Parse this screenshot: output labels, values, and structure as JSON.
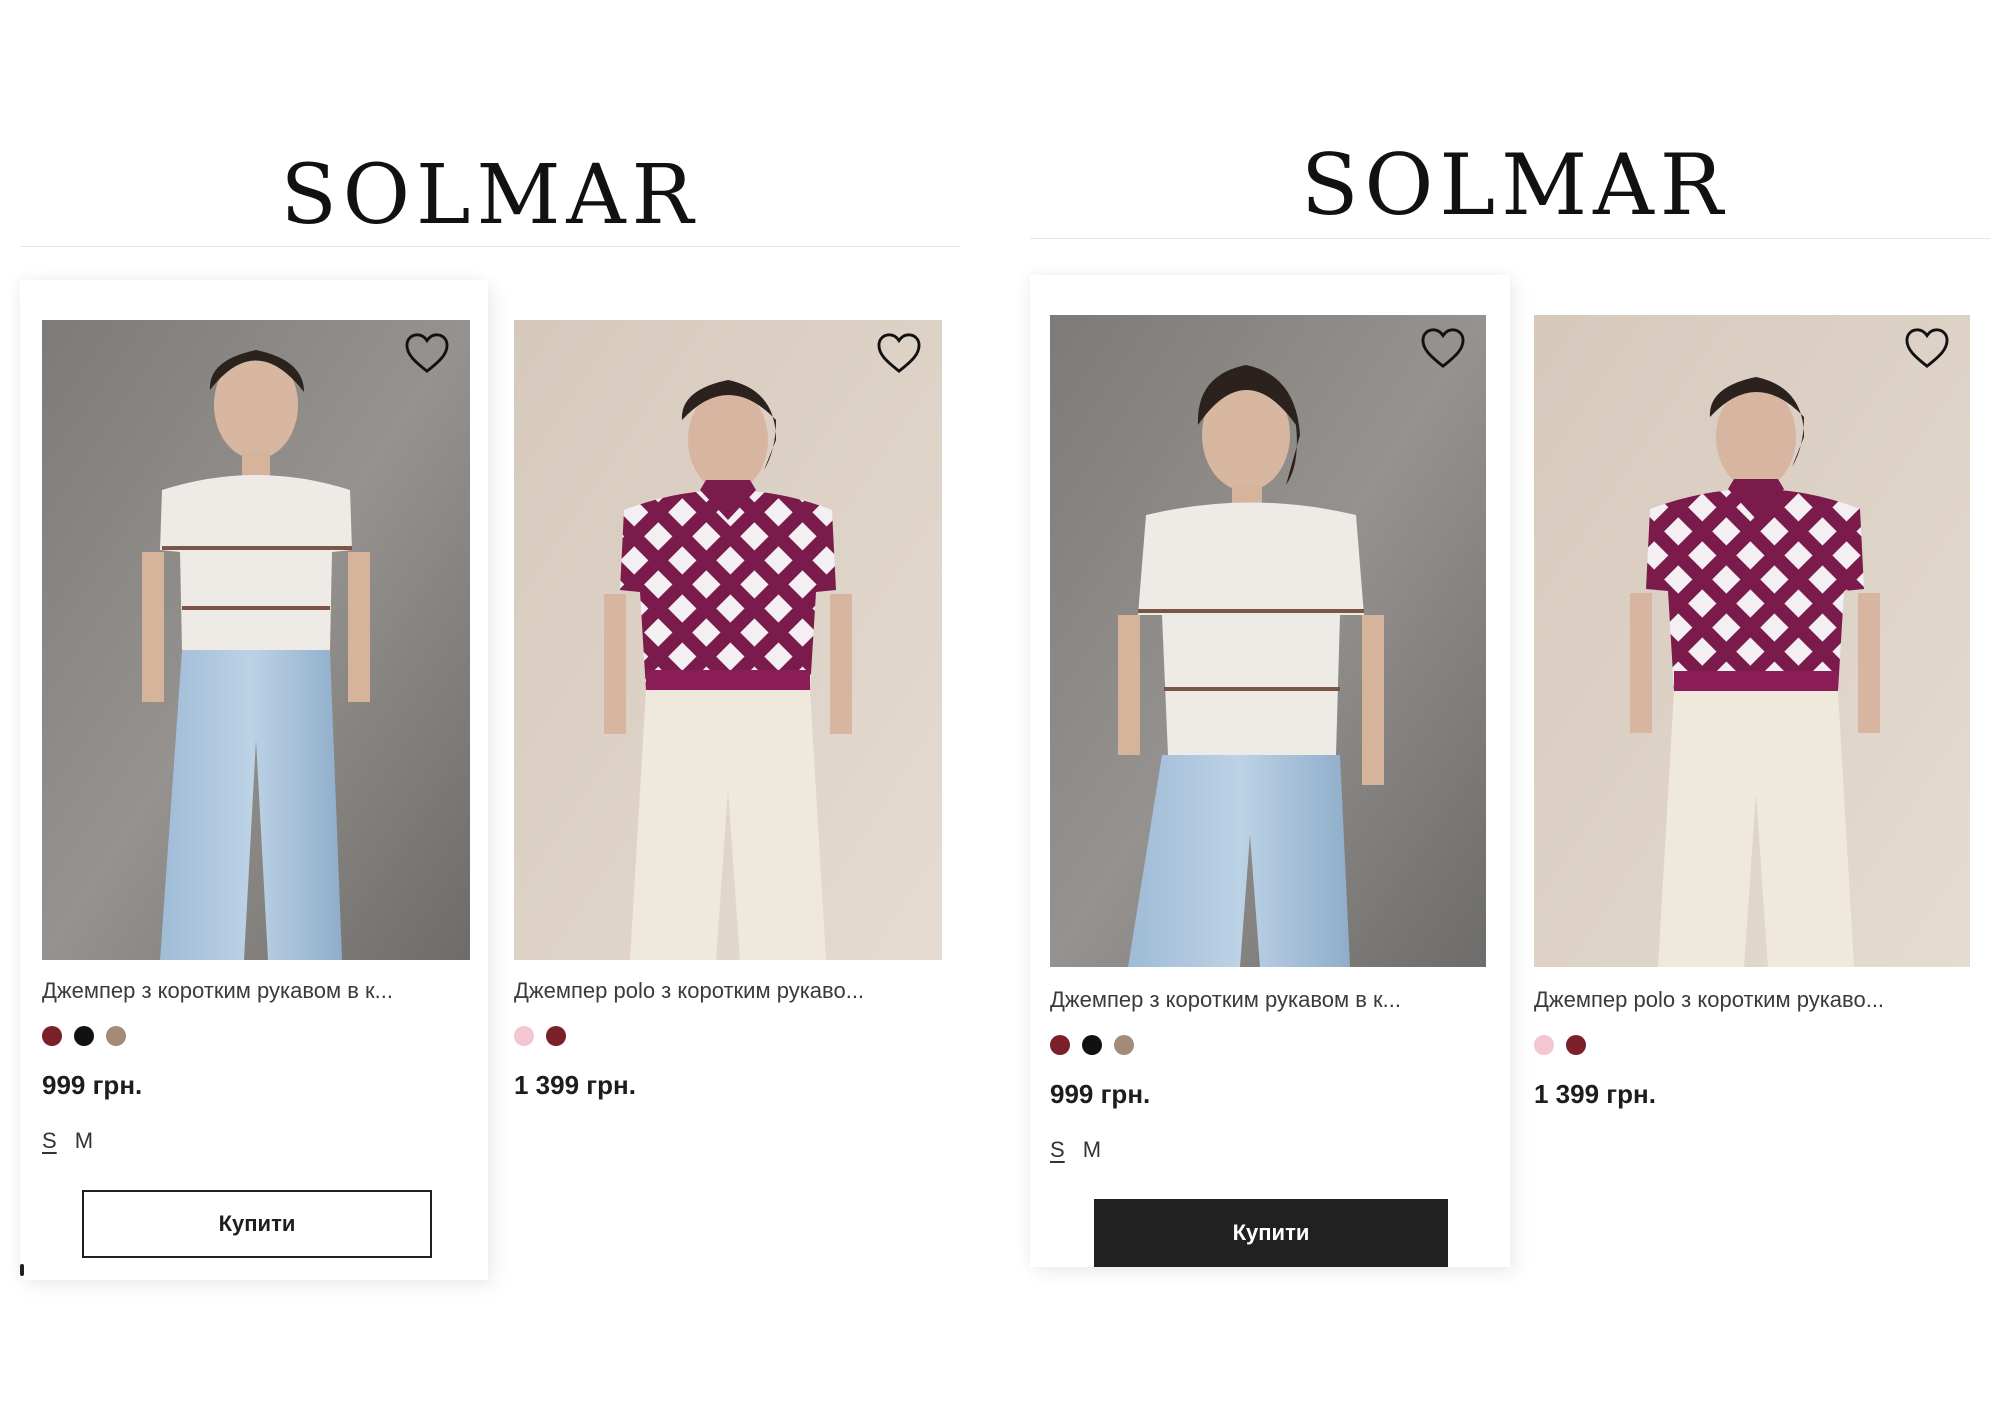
{
  "brand": {
    "logo_text": "SOLMAR"
  },
  "colors": {
    "burgundy": "#7b1f2a",
    "black": "#111111",
    "beige": "#a38b77",
    "pink": "#f3c6d2",
    "button_dark": "#212121"
  },
  "heart_icon": "heart-outline-icon",
  "panels": [
    {
      "variant": "default",
      "products": [
        {
          "title": "Джемпер з коротким рукавом в к...",
          "colors": [
            "#7b1f2a",
            "#111111",
            "#a38b77"
          ],
          "price": "999 грн.",
          "sizes": [
            "S",
            "M"
          ],
          "active_size": "S",
          "buy_label": "Купити"
        },
        {
          "title": "Джемпер polo з коротким рукаво...",
          "colors": [
            "#f3c6d2",
            "#7b1f2a"
          ],
          "price": "1 399 грн."
        }
      ]
    },
    {
      "variant": "hover",
      "products": [
        {
          "title": "Джемпер з коротким рукавом в к...",
          "colors": [
            "#7b1f2a",
            "#111111",
            "#a38b77"
          ],
          "price": "999 грн.",
          "sizes": [
            "S",
            "M"
          ],
          "active_size": "S",
          "buy_label": "Купити"
        },
        {
          "title": "Джемпер polo з коротким рукаво...",
          "colors": [
            "#f3c6d2",
            "#7b1f2a"
          ],
          "price": "1 399 грн."
        }
      ]
    }
  ]
}
